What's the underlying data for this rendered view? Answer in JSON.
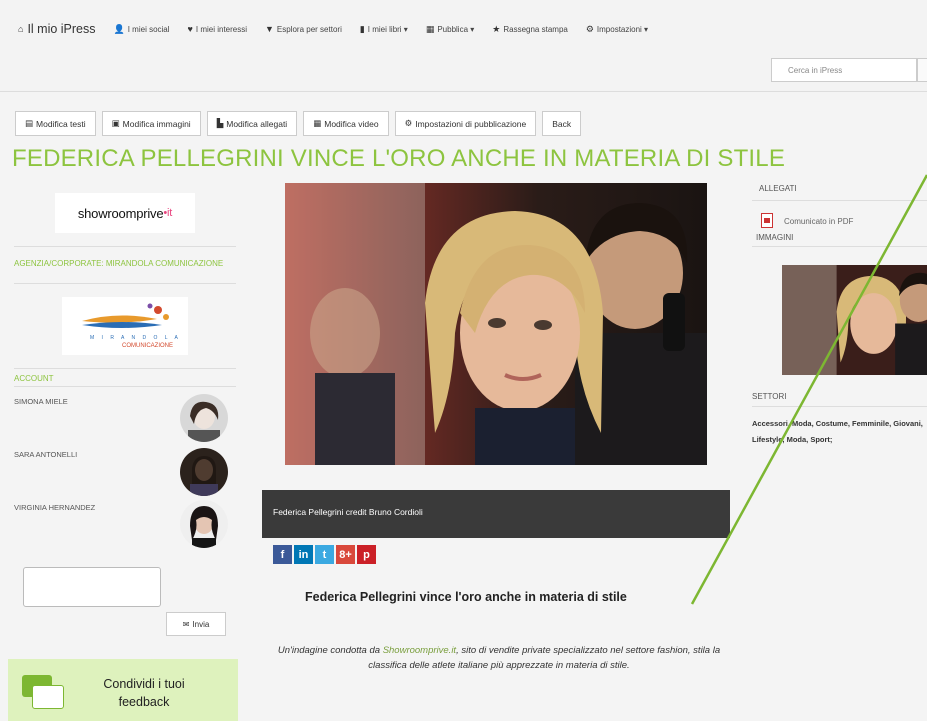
{
  "navbar": {
    "brand": "Il mio iPress",
    "items": [
      {
        "label": "I miei social",
        "icon": "user-icon"
      },
      {
        "label": "I miei interessi",
        "icon": "heart-icon"
      },
      {
        "label": "Esplora per settori",
        "icon": "filter-icon"
      },
      {
        "label": "I miei libri ▾",
        "icon": "book-icon"
      },
      {
        "label": "Pubblica ▾",
        "icon": "grid-icon"
      },
      {
        "label": "Rassegna stampa",
        "icon": "star-icon"
      },
      {
        "label": "Impostazioni ▾",
        "icon": "gear-icon"
      }
    ],
    "search_placeholder": "Cerca in iPress"
  },
  "toolbar": {
    "buttons": [
      {
        "label": "Modifica testi",
        "icon": "list-icon"
      },
      {
        "label": "Modifica immagini",
        "icon": "image-icon"
      },
      {
        "label": "Modifica allegati",
        "icon": "file-icon"
      },
      {
        "label": "Modifica video",
        "icon": "film-icon"
      },
      {
        "label": "Impostazioni di pubblicazione",
        "icon": "gear-icon"
      },
      {
        "label": "Back",
        "icon": ""
      }
    ]
  },
  "page_title": "FEDERICA PELLEGRINI VINCE L'ORO ANCHE IN MATERIA DI STILE",
  "sidebar": {
    "showroom_logo": "showroomprive",
    "showroom_logo_suffix": "•it",
    "agency_label": "AGENZIA/CORPORATE: MIRANDOLA COMUNICAZIONE",
    "mirandola_logo": "M I R A N D O L A",
    "mirandola_sub": "COMUNICAZIONE",
    "account_label": "ACCOUNT",
    "accounts": [
      {
        "name": "SIMONA MIELE"
      },
      {
        "name": "SARA ANTONELLI"
      },
      {
        "name": "VIRGINIA HERNANDEZ"
      }
    ],
    "send_label": "Invia",
    "feedback_text": "Condividi i tuoi feedback"
  },
  "article": {
    "caption": "Federica Pellegrini credit Bruno Cordioli",
    "social": [
      {
        "name": "facebook",
        "glyph": "f",
        "color": "#3b5998"
      },
      {
        "name": "linkedin",
        "glyph": "in",
        "color": "#0077b5"
      },
      {
        "name": "twitter",
        "glyph": "t",
        "color": "#3ba9e1"
      },
      {
        "name": "googleplus",
        "glyph": "8+",
        "color": "#d9483b"
      },
      {
        "name": "pinterest",
        "glyph": "p",
        "color": "#cb2027"
      }
    ],
    "headline": "Federica Pellegrini vince l'oro anche in materia di stile",
    "intro_pre": "Un'indagine condotta da ",
    "intro_link": "Showroomprive.it",
    "intro_post": ", sito di vendite private specializzato nel settore fashion, stila la classifica delle atlete italiane più apprezzate in materia di stile."
  },
  "right": {
    "allegati_label": "ALLEGATI",
    "pdf_label": "Comunicato in PDF",
    "immagini_label": "IMMAGINI",
    "settori_label": "SETTORI",
    "settori_text": "Accessori, Moda, Costume, Femminile, Giovani, Lifestyle, Moda, Sport;"
  },
  "colors": {
    "accent": "#8dc43f",
    "arrow": "#7db732"
  }
}
